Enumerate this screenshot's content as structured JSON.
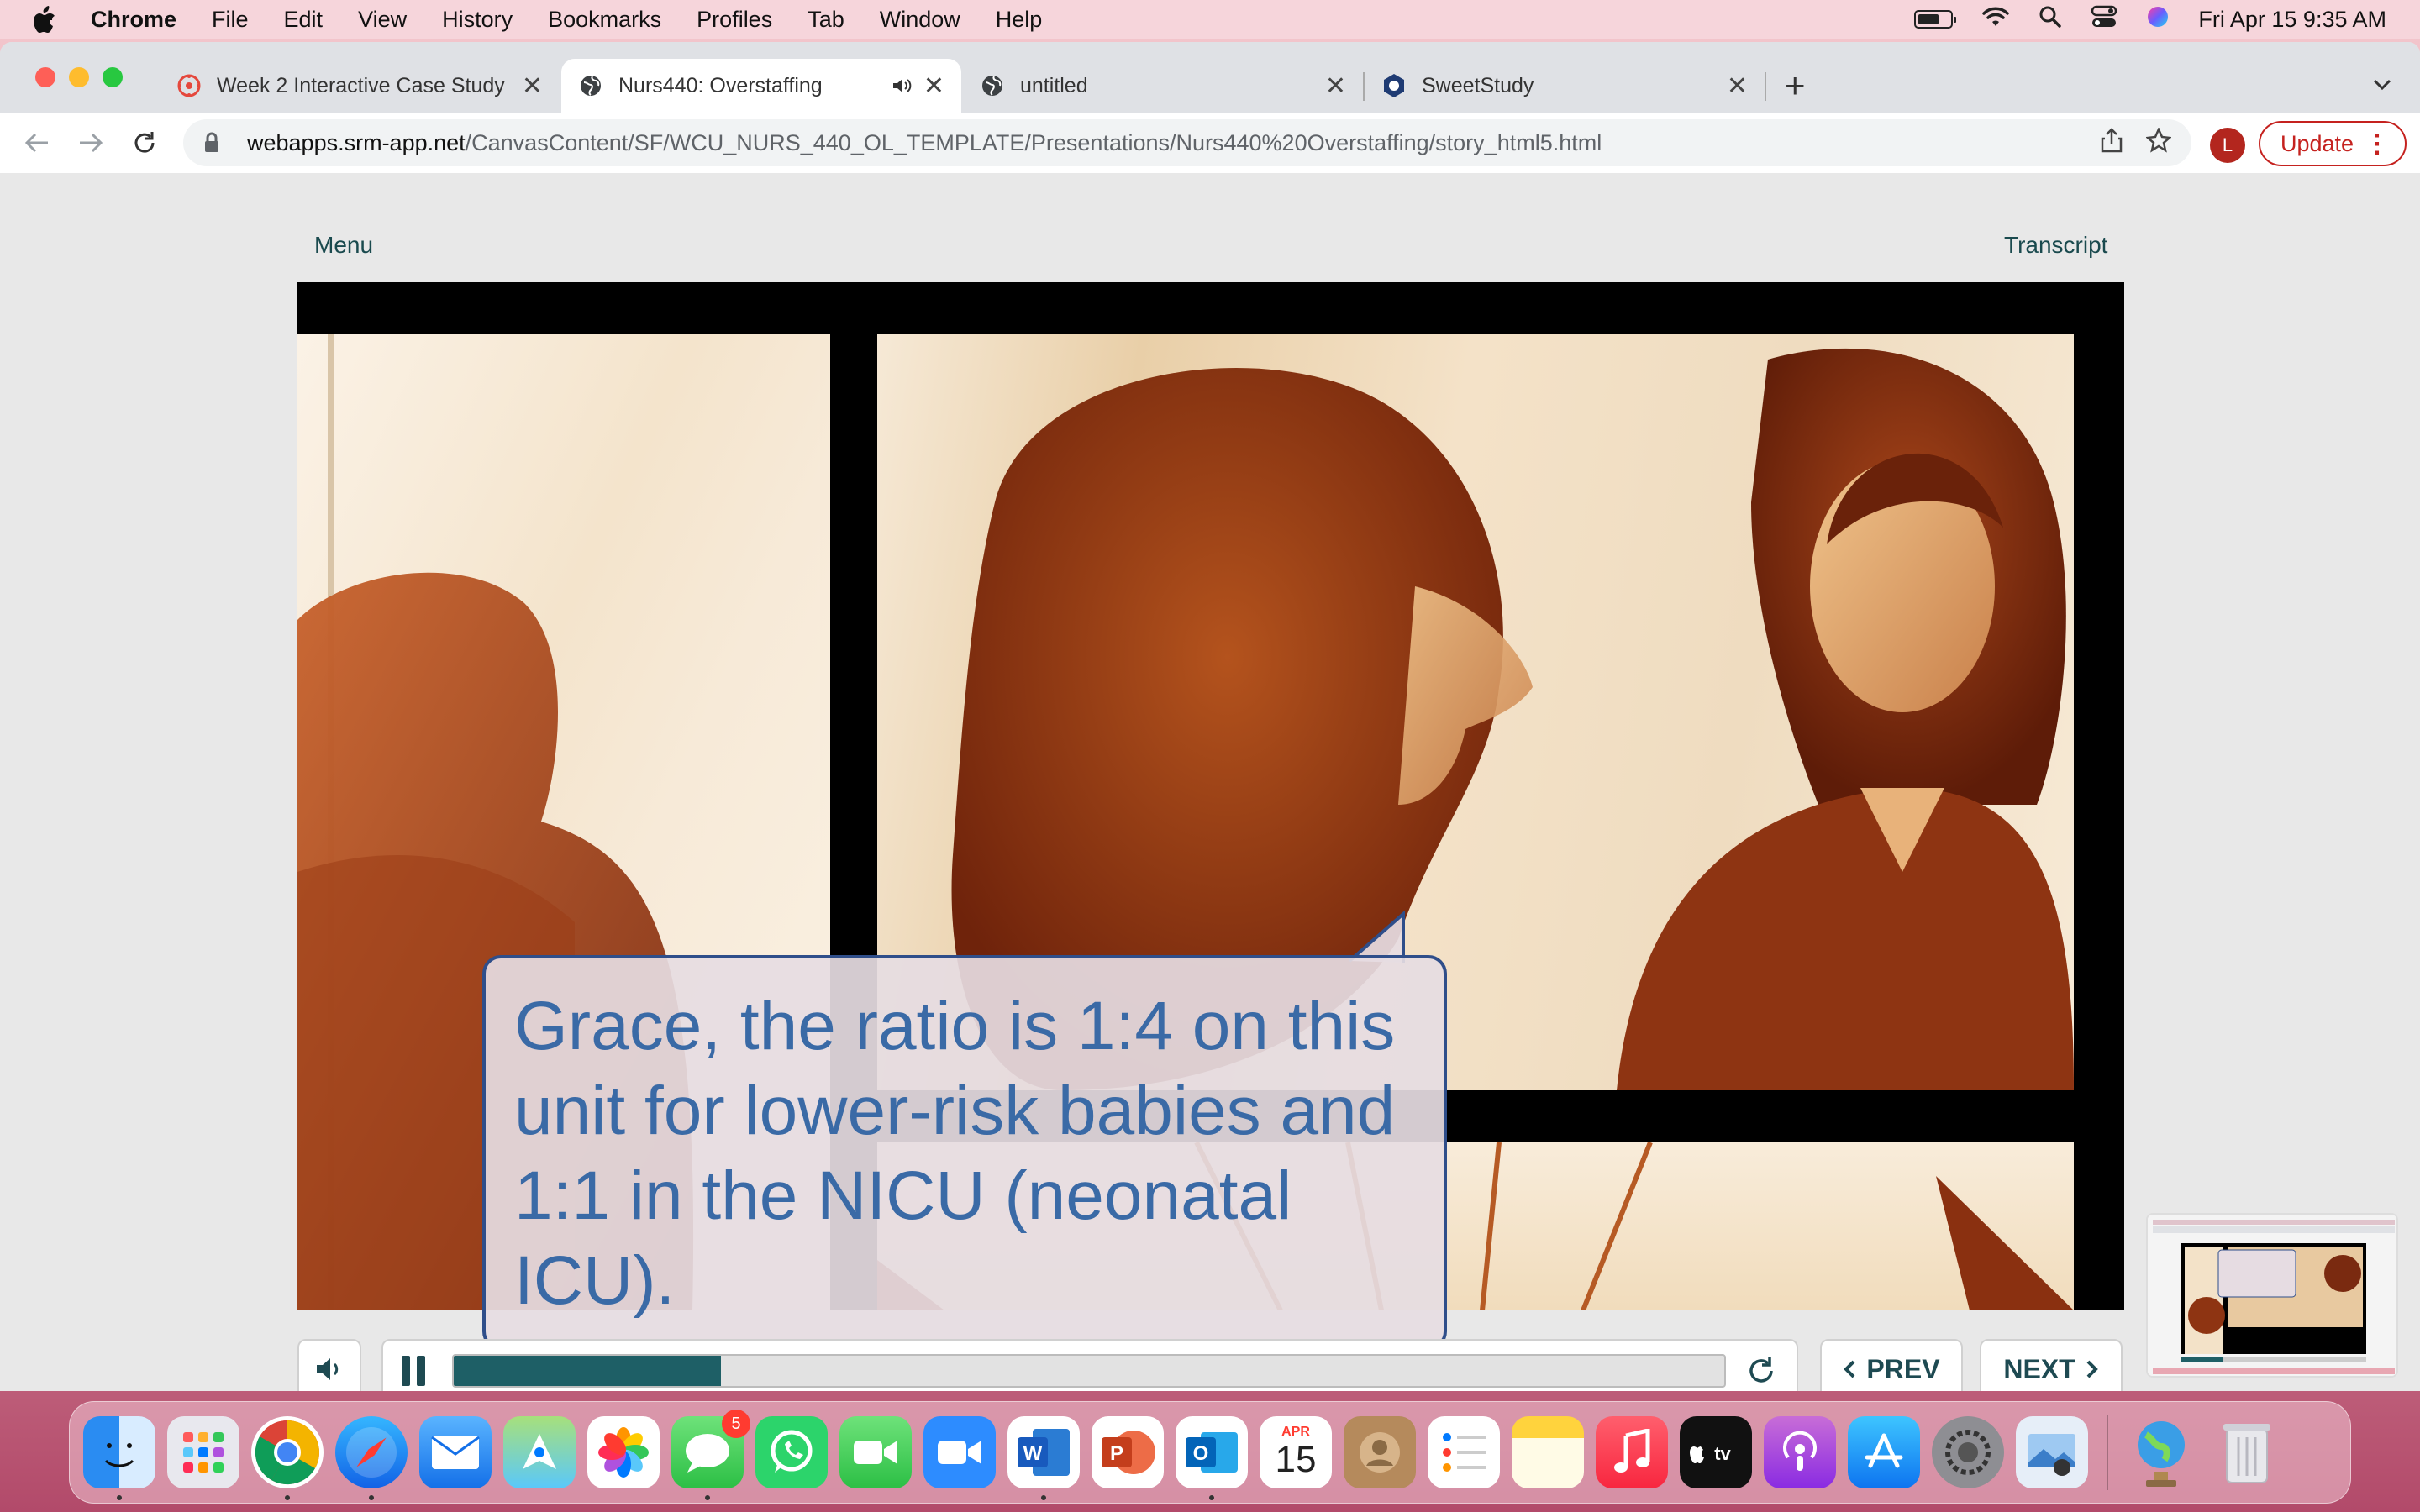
{
  "menubar": {
    "app_name": "Chrome",
    "items": [
      "File",
      "Edit",
      "View",
      "History",
      "Bookmarks",
      "Profiles",
      "Tab",
      "Window",
      "Help"
    ],
    "clock": "Fri Apr 15  9:35 AM"
  },
  "tabs": [
    {
      "label": "Week 2 Interactive Case Study",
      "icon": "canvas-icon"
    },
    {
      "label": "Nurs440: Overstaffing",
      "icon": "globe-icon",
      "active": true,
      "audio": true
    },
    {
      "label": "untitled",
      "icon": "globe-icon"
    },
    {
      "label": "SweetStudy",
      "icon": "sweetstudy-icon"
    }
  ],
  "address_bar": {
    "host": "webapps.srm-app.net",
    "path": "/CanvasContent/SF/WCU_NURS_440_OL_TEMPLATE/Presentations/Nurs440%20Overstaffing/story_html5.html"
  },
  "profile": {
    "initial": "L"
  },
  "update_button": {
    "label": "Update"
  },
  "player": {
    "menu_label": "Menu",
    "transcript_label": "Transcript",
    "caption": "Grace, the ratio is 1:4 on this unit for lower-risk babies and 1:1 in the NICU (neonatal ICU).",
    "progress": 0.21,
    "prev_label": "PREV",
    "next_label": "NEXT"
  },
  "dock": {
    "calendar_month": "APR",
    "calendar_day": "15",
    "messages_badge": "5",
    "apps": [
      "Finder",
      "Launchpad",
      "Chrome",
      "Safari",
      "Mail",
      "Maps",
      "Photos",
      "Messages",
      "WhatsApp",
      "FaceTime",
      "Zoom",
      "Word",
      "PowerPoint",
      "Outlook",
      "Calendar",
      "Contacts",
      "Reminders",
      "Notes",
      "Music",
      "TV",
      "Podcasts",
      "App Store",
      "System Preferences",
      "Preview",
      "Network",
      "Trash"
    ]
  },
  "colors": {
    "accent": "#1e5f66",
    "callout_text": "#3a6aa6",
    "callout_border": "#2f4e8a",
    "update_red": "#c5221f"
  }
}
